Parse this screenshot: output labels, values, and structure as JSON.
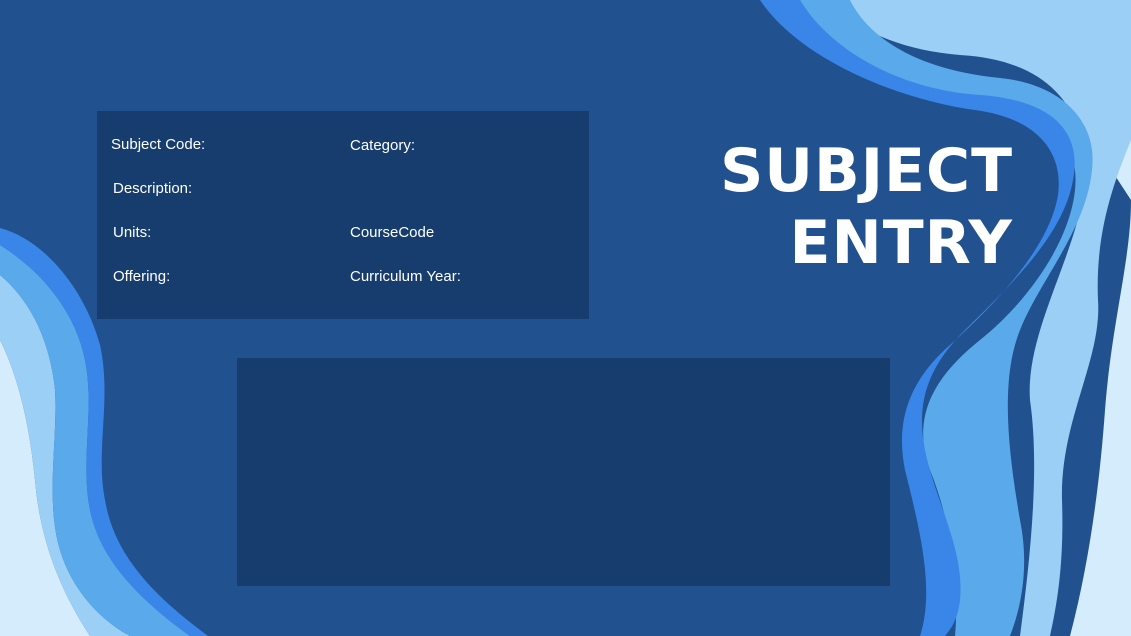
{
  "title": {
    "line1": "SUBJECT",
    "line2": "ENTRY"
  },
  "form": {
    "subject_code_label": "Subject Code:",
    "category_label": "Category:",
    "description_label": "Description:",
    "units_label": "Units:",
    "course_code_label": "CourseCode",
    "offering_label": "Offering:",
    "curriculum_year_label": "Curriculum Year:"
  },
  "colors": {
    "background": "#21528f",
    "panel": "#163d6e",
    "wave_bright": "#3a86e8",
    "wave_mid": "#5aa9ea",
    "wave_light": "#9ccff5",
    "wave_pale": "#d5ecfc"
  }
}
